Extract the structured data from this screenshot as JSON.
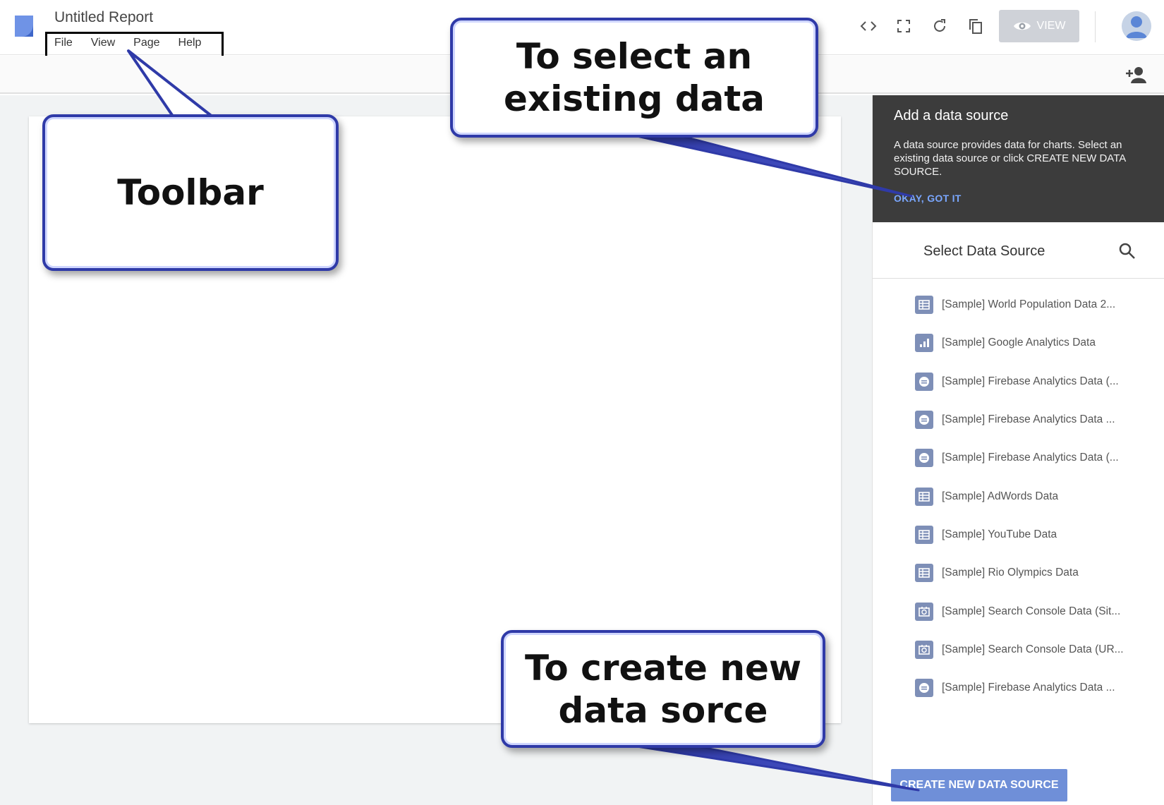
{
  "header": {
    "title": "Untitled Report",
    "menu": [
      "File",
      "View",
      "Page",
      "Help"
    ],
    "icons": [
      "embed-icon",
      "fullscreen-icon",
      "refresh-icon",
      "copy-icon"
    ],
    "view_label": "VIEW"
  },
  "panel": {
    "tooltip": {
      "title": "Add a data source",
      "text": "A data source provides data for charts. Select an existing data source or click CREATE NEW DATA SOURCE.",
      "link": "OKAY, GOT IT"
    },
    "select_title": "Select Data Source",
    "items": [
      {
        "label": "[Sample] World Population Data 2...",
        "icon": "table-icon"
      },
      {
        "label": "[Sample] Google Analytics Data",
        "icon": "analytics-icon"
      },
      {
        "label": "[Sample] Firebase Analytics Data (...",
        "icon": "firebase-icon"
      },
      {
        "label": "[Sample] Firebase Analytics Data ...",
        "icon": "firebase-icon"
      },
      {
        "label": "[Sample] Firebase Analytics Data (...",
        "icon": "firebase-icon"
      },
      {
        "label": "[Sample] AdWords Data",
        "icon": "table-icon"
      },
      {
        "label": "[Sample] YouTube Data",
        "icon": "table-icon"
      },
      {
        "label": "[Sample] Rio Olympics Data",
        "icon": "table-icon"
      },
      {
        "label": "[Sample] Search Console Data (Sit...",
        "icon": "search-console-icon"
      },
      {
        "label": "[Sample] Search Console Data (UR...",
        "icon": "search-console-icon"
      },
      {
        "label": "[Sample] Firebase Analytics Data ...",
        "icon": "firebase-icon"
      }
    ],
    "create_button": "CREATE NEW DATA SOURCE"
  },
  "callouts": {
    "toolbar": "Toolbar",
    "select": "To select an existing data",
    "create": "To create new data sorce"
  },
  "colors": {
    "accent": "#6f8fd8",
    "tooltip_bg": "#3c3c3c",
    "callout_border": "#2f3aa8"
  }
}
